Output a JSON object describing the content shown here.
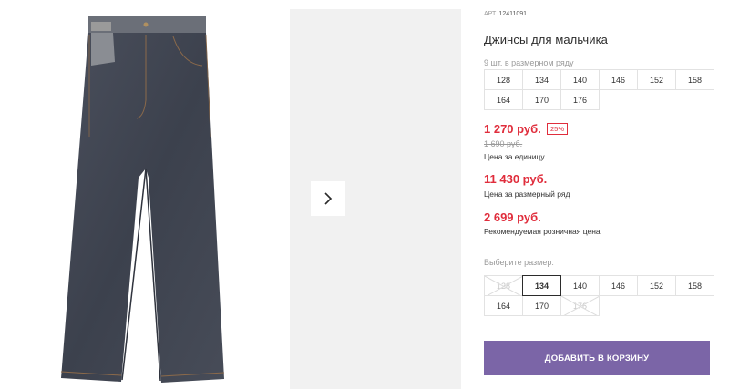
{
  "gallery": {
    "main_image": "boys-jeans-photo",
    "next_icon": "chevron-right-icon"
  },
  "product": {
    "article_label": "АРТ.",
    "article_number": "12411091",
    "title": "Джинсы для мальчика",
    "range_caption": "9 шт. в размерном ряду",
    "size_range": [
      "128",
      "134",
      "140",
      "146",
      "152",
      "158",
      "164",
      "170",
      "176"
    ]
  },
  "prices": {
    "unit_price": "1 270 руб.",
    "discount": "25%",
    "old_price": "1 690 руб.",
    "unit_note": "Цена за единицу",
    "range_price": "11 430 руб.",
    "range_note": "Цена за размерный ряд",
    "retail_price": "2 699 руб.",
    "retail_note": "Рекомендуемая розничная цена",
    "accent_color": "#e02d3c"
  },
  "size_picker": {
    "caption": "Выберите размер:",
    "sizes": [
      {
        "label": "128",
        "available": false,
        "selected": false
      },
      {
        "label": "134",
        "available": true,
        "selected": true
      },
      {
        "label": "140",
        "available": true,
        "selected": false
      },
      {
        "label": "146",
        "available": true,
        "selected": false
      },
      {
        "label": "152",
        "available": true,
        "selected": false
      },
      {
        "label": "158",
        "available": true,
        "selected": false
      },
      {
        "label": "164",
        "available": true,
        "selected": false
      },
      {
        "label": "170",
        "available": true,
        "selected": false
      },
      {
        "label": "176",
        "available": false,
        "selected": false
      }
    ]
  },
  "cart": {
    "button_label": "ДОБАВИТЬ В КОРЗИНУ",
    "button_color": "#7b65a7"
  }
}
